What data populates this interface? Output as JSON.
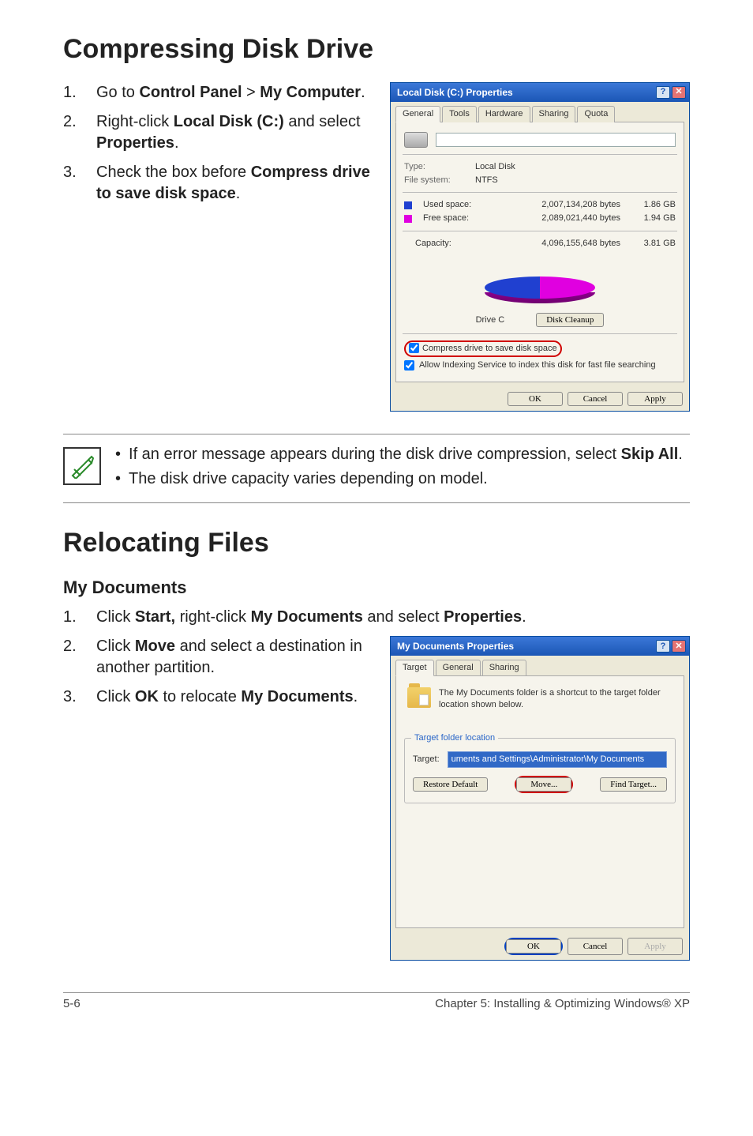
{
  "section1": {
    "heading": "Compressing Disk Drive",
    "steps": [
      {
        "pre": "Go to ",
        "b1": "Control Panel",
        "mid": " > ",
        "b2": "My Computer",
        "post": "."
      },
      {
        "pre": "Right-click ",
        "b1": "Local Disk (C:)",
        "mid": " and select ",
        "b2": "Properties",
        "post": "."
      },
      {
        "pre": "Check the box before ",
        "b1": "Compress drive to save disk space",
        "mid": "",
        "b2": "",
        "post": "."
      }
    ]
  },
  "dialog1": {
    "title": "Local Disk (C:) Properties",
    "tabs": [
      "General",
      "Tools",
      "Hardware",
      "Sharing",
      "Quota"
    ],
    "type_label": "Type:",
    "type_value": "Local Disk",
    "fs_label": "File system:",
    "fs_value": "NTFS",
    "used_label": "Used space:",
    "used_bytes": "2,007,134,208 bytes",
    "used_gb": "1.86 GB",
    "free_label": "Free space:",
    "free_bytes": "2,089,021,440 bytes",
    "free_gb": "1.94 GB",
    "cap_label": "Capacity:",
    "cap_bytes": "4,096,155,648 bytes",
    "cap_gb": "3.81 GB",
    "drive_label": "Drive C",
    "cleanup_btn": "Disk Cleanup",
    "compress_check": "Compress drive to save disk space",
    "index_check": "Allow Indexing Service to index this disk for fast file searching",
    "ok": "OK",
    "cancel": "Cancel",
    "apply": "Apply"
  },
  "note": {
    "item1_pre": "If an error message appears during the disk drive compression, select ",
    "item1_b": "Skip All",
    "item1_post": ".",
    "item2": "The disk drive capacity varies depending on model."
  },
  "section2": {
    "heading": "Relocating Files",
    "sub": "My Documents",
    "steps": [
      {
        "pre": "Click ",
        "b1": "Start,",
        "mid": " right-click ",
        "b2": "My Documents",
        "mid2": " and select ",
        "b3": "Properties",
        "post": "."
      },
      {
        "pre": "Click ",
        "b1": "Move",
        "mid": " and select a destination in another partition.",
        "b2": "",
        "post": ""
      },
      {
        "pre": "Click ",
        "b1": "OK",
        "mid": " to relocate ",
        "b2": "My Documents",
        "post": "."
      }
    ]
  },
  "dialog2": {
    "title": "My Documents Properties",
    "tabs": [
      "Target",
      "General",
      "Sharing"
    ],
    "desc": "The My Documents folder is a shortcut to the target folder location shown below.",
    "fieldset": "Target folder location",
    "target_label": "Target:",
    "target_value": "uments and Settings\\Administrator\\My Documents",
    "restore": "Restore Default",
    "move": "Move...",
    "find": "Find Target...",
    "ok": "OK",
    "cancel": "Cancel",
    "apply": "Apply"
  },
  "footer": {
    "left": "5-6",
    "right": "Chapter 5: Installing & Optimizing Windows® XP"
  }
}
